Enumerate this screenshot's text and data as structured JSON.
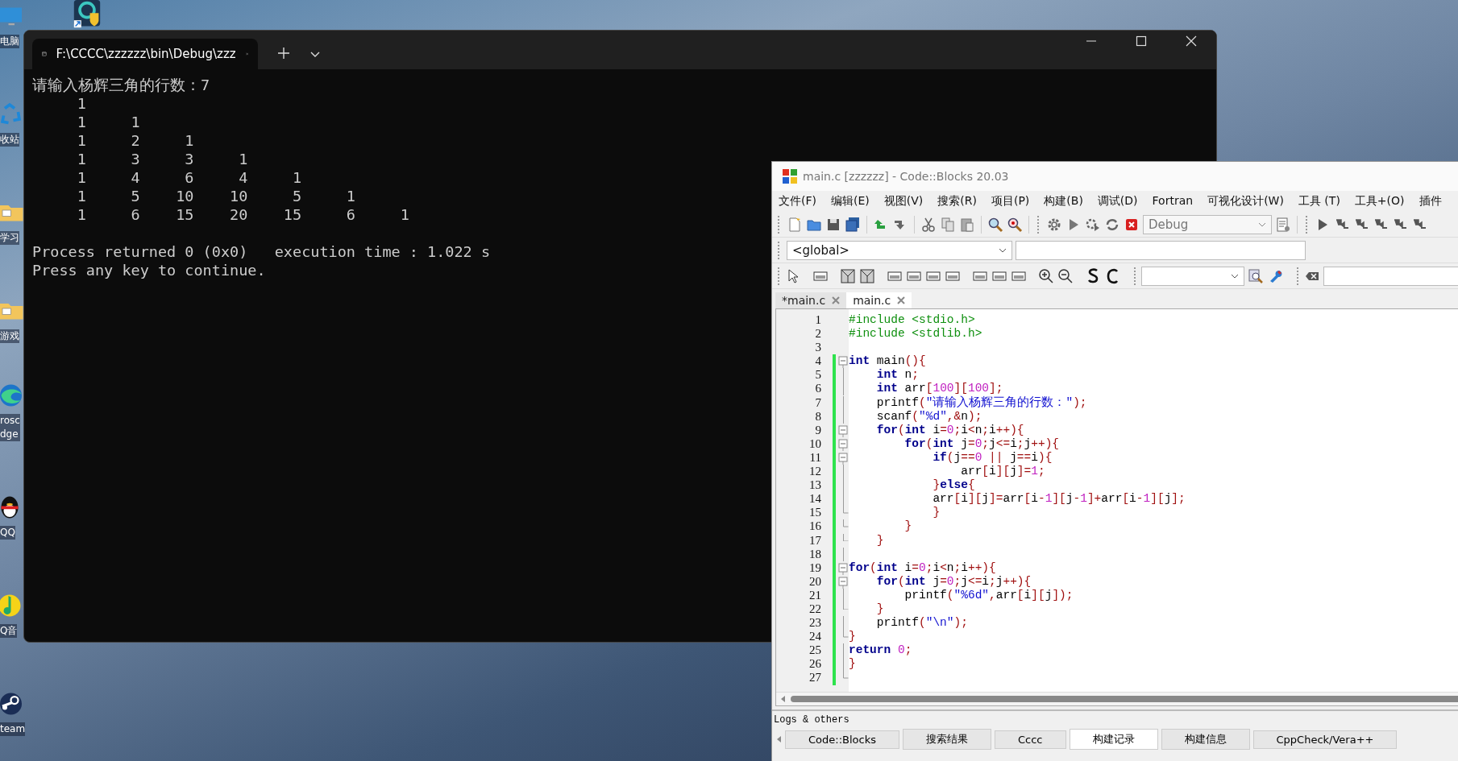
{
  "desktop": {
    "icons": [
      {
        "kind": "pc",
        "label_lines": [
          "电脑"
        ]
      },
      {
        "kind": "recycle",
        "label_lines": [
          "收站"
        ]
      },
      {
        "kind": "folder",
        "label_lines": [
          "学习"
        ]
      },
      {
        "kind": "folder",
        "label_lines": [
          "游戏"
        ]
      },
      {
        "kind": "edge",
        "label_lines": [
          "rosc",
          "dge"
        ]
      },
      {
        "kind": "qq",
        "label_lines": [
          "QQ"
        ]
      },
      {
        "kind": "music",
        "label_lines": [
          "Q音"
        ]
      },
      {
        "kind": "steam",
        "label_lines": [
          "team"
        ]
      }
    ]
  },
  "terminal": {
    "tab_title": "F:\\CCCC\\zzzzzz\\bin\\Debug\\zzz",
    "output_lines": [
      "请输入杨辉三角的行数：7",
      "     1",
      "     1     1",
      "     1     2     1",
      "     1     3     3     1",
      "     1     4     6     4     1",
      "     1     5    10    10     5     1",
      "     1     6    15    20    15     6     1"
    ],
    "status_lines": [
      "Process returned 0 (0x0)   execution time : 1.022 s",
      "Press any key to continue."
    ]
  },
  "codeblocks": {
    "title": "main.c [zzzzzz] - Code::Blocks 20.03",
    "menu": [
      "文件(F)",
      "编辑(E)",
      "视图(V)",
      "搜索(R)",
      "项目(P)",
      "构建(B)",
      "调试(D)",
      "Fortran",
      "可视化设计(W)",
      "工具 (T)",
      "工具+(O)",
      "插件"
    ],
    "build_target": "Debug",
    "scope": "<global>",
    "tabs": [
      {
        "label": "*main.c",
        "selected": false
      },
      {
        "label": "main.c",
        "selected": true
      }
    ],
    "code_lines": [
      {
        "n": "1",
        "kind": "plain",
        "changed": false,
        "tokens": [
          {
            "kind": "pre",
            "text": "#include <stdio.h>"
          }
        ]
      },
      {
        "n": "2",
        "kind": "plain",
        "changed": false,
        "tokens": [
          {
            "kind": "pre",
            "text": "#include <stdlib.h>"
          }
        ]
      },
      {
        "n": "3",
        "kind": "plain",
        "changed": false
      },
      {
        "n": "4",
        "kind": "fold-start",
        "changed": true,
        "tokens": [
          {
            "kind": "kw",
            "text": "int"
          },
          {
            "kind": "id",
            "text": " main"
          },
          {
            "kind": "op",
            "text": "(){"
          }
        ]
      },
      {
        "n": "5",
        "kind": "fold-body",
        "changed": true,
        "tokens": [
          {
            "kind": "kw",
            "text": "    int"
          },
          {
            "kind": "id",
            "text": " n"
          },
          {
            "kind": "op",
            "text": ";"
          }
        ]
      },
      {
        "n": "6",
        "kind": "fold-body",
        "changed": true,
        "tokens": [
          {
            "kind": "kw",
            "text": "    int"
          },
          {
            "kind": "id",
            "text": " arr"
          },
          {
            "kind": "op",
            "text": "["
          },
          {
            "kind": "num",
            "text": "100"
          },
          {
            "kind": "op",
            "text": "]["
          },
          {
            "kind": "num",
            "text": "100"
          },
          {
            "kind": "op",
            "text": "];"
          }
        ]
      },
      {
        "n": "7",
        "kind": "fold-body",
        "changed": true,
        "tokens": [
          {
            "kind": "id",
            "text": "    printf"
          },
          {
            "kind": "op",
            "text": "("
          },
          {
            "kind": "str",
            "text": "\"请输入杨辉三角的行数：\""
          },
          {
            "kind": "op",
            "text": ");"
          }
        ]
      },
      {
        "n": "8",
        "kind": "fold-body",
        "changed": true,
        "tokens": [
          {
            "kind": "id",
            "text": "    scanf"
          },
          {
            "kind": "op",
            "text": "("
          },
          {
            "kind": "str",
            "text": "\"%d\""
          },
          {
            "kind": "op",
            "text": ",&"
          },
          {
            "kind": "id",
            "text": "n"
          },
          {
            "kind": "op",
            "text": ");"
          }
        ]
      },
      {
        "n": "9",
        "kind": "fold-start",
        "changed": true,
        "tokens": [
          {
            "kind": "kw",
            "text": "    for"
          },
          {
            "kind": "op",
            "text": "("
          },
          {
            "kind": "kw",
            "text": "int"
          },
          {
            "kind": "id",
            "text": " i"
          },
          {
            "kind": "op",
            "text": "="
          },
          {
            "kind": "num",
            "text": "0"
          },
          {
            "kind": "op",
            "text": ";"
          },
          {
            "kind": "id",
            "text": "i"
          },
          {
            "kind": "op",
            "text": "<"
          },
          {
            "kind": "id",
            "text": "n"
          },
          {
            "kind": "op",
            "text": ";"
          },
          {
            "kind": "id",
            "text": "i"
          },
          {
            "kind": "op",
            "text": "++){"
          }
        ]
      },
      {
        "n": "10",
        "kind": "fold-start",
        "changed": true,
        "tokens": [
          {
            "kind": "kw",
            "text": "        for"
          },
          {
            "kind": "op",
            "text": "("
          },
          {
            "kind": "kw",
            "text": "int"
          },
          {
            "kind": "id",
            "text": " j"
          },
          {
            "kind": "op",
            "text": "="
          },
          {
            "kind": "num",
            "text": "0"
          },
          {
            "kind": "op",
            "text": ";"
          },
          {
            "kind": "id",
            "text": "j"
          },
          {
            "kind": "op",
            "text": "<="
          },
          {
            "kind": "id",
            "text": "i"
          },
          {
            "kind": "op",
            "text": ";"
          },
          {
            "kind": "id",
            "text": "j"
          },
          {
            "kind": "op",
            "text": "++){"
          }
        ]
      },
      {
        "n": "11",
        "kind": "fold-start",
        "changed": true,
        "tokens": [
          {
            "kind": "kw",
            "text": "            if"
          },
          {
            "kind": "op",
            "text": "("
          },
          {
            "kind": "id",
            "text": "j"
          },
          {
            "kind": "op",
            "text": "=="
          },
          {
            "kind": "num",
            "text": "0"
          },
          {
            "kind": "op",
            "text": " || "
          },
          {
            "kind": "id",
            "text": "j"
          },
          {
            "kind": "op",
            "text": "=="
          },
          {
            "kind": "id",
            "text": "i"
          },
          {
            "kind": "op",
            "text": "){"
          }
        ]
      },
      {
        "n": "12",
        "kind": "fold-body",
        "changed": true,
        "tokens": [
          {
            "kind": "id",
            "text": "                arr"
          },
          {
            "kind": "op",
            "text": "["
          },
          {
            "kind": "id",
            "text": "i"
          },
          {
            "kind": "op",
            "text": "]["
          },
          {
            "kind": "id",
            "text": "j"
          },
          {
            "kind": "op",
            "text": "]="
          },
          {
            "kind": "num",
            "text": "1"
          },
          {
            "kind": "op",
            "text": ";"
          }
        ]
      },
      {
        "n": "13",
        "kind": "fold-body",
        "changed": true,
        "tokens": [
          {
            "kind": "op",
            "text": "            }"
          },
          {
            "kind": "kw",
            "text": "else"
          },
          {
            "kind": "op",
            "text": "{"
          }
        ]
      },
      {
        "n": "14",
        "kind": "fold-body",
        "changed": true,
        "tokens": [
          {
            "kind": "id",
            "text": "            arr"
          },
          {
            "kind": "op",
            "text": "["
          },
          {
            "kind": "id",
            "text": "i"
          },
          {
            "kind": "op",
            "text": "]["
          },
          {
            "kind": "id",
            "text": "j"
          },
          {
            "kind": "op",
            "text": "]="
          },
          {
            "kind": "id",
            "text": "arr"
          },
          {
            "kind": "op",
            "text": "["
          },
          {
            "kind": "id",
            "text": "i"
          },
          {
            "kind": "op",
            "text": "-"
          },
          {
            "kind": "num",
            "text": "1"
          },
          {
            "kind": "op",
            "text": "]["
          },
          {
            "kind": "id",
            "text": "j"
          },
          {
            "kind": "op",
            "text": "-"
          },
          {
            "kind": "num",
            "text": "1"
          },
          {
            "kind": "op",
            "text": "]+"
          },
          {
            "kind": "id",
            "text": "arr"
          },
          {
            "kind": "op",
            "text": "["
          },
          {
            "kind": "id",
            "text": "i"
          },
          {
            "kind": "op",
            "text": "-"
          },
          {
            "kind": "num",
            "text": "1"
          },
          {
            "kind": "op",
            "text": "]["
          },
          {
            "kind": "id",
            "text": "j"
          },
          {
            "kind": "op",
            "text": "];"
          }
        ]
      },
      {
        "n": "15",
        "kind": "fold-end",
        "changed": true,
        "tokens": [
          {
            "kind": "op",
            "text": "            }"
          }
        ]
      },
      {
        "n": "16",
        "kind": "fold-end",
        "changed": true,
        "tokens": [
          {
            "kind": "op",
            "text": "        }"
          }
        ]
      },
      {
        "n": "17",
        "kind": "fold-end",
        "changed": true,
        "tokens": [
          {
            "kind": "op",
            "text": "    }"
          }
        ]
      },
      {
        "n": "18",
        "kind": "fold-body",
        "changed": true
      },
      {
        "n": "19",
        "kind": "fold-start",
        "changed": true,
        "tokens": [
          {
            "kind": "kw",
            "text": "for"
          },
          {
            "kind": "op",
            "text": "("
          },
          {
            "kind": "kw",
            "text": "int"
          },
          {
            "kind": "id",
            "text": " i"
          },
          {
            "kind": "op",
            "text": "="
          },
          {
            "kind": "num",
            "text": "0"
          },
          {
            "kind": "op",
            "text": ";"
          },
          {
            "kind": "id",
            "text": "i"
          },
          {
            "kind": "op",
            "text": "<"
          },
          {
            "kind": "id",
            "text": "n"
          },
          {
            "kind": "op",
            "text": ";"
          },
          {
            "kind": "id",
            "text": "i"
          },
          {
            "kind": "op",
            "text": "++){"
          }
        ]
      },
      {
        "n": "20",
        "kind": "fold-start",
        "changed": true,
        "tokens": [
          {
            "kind": "kw",
            "text": "    for"
          },
          {
            "kind": "op",
            "text": "("
          },
          {
            "kind": "kw",
            "text": "int"
          },
          {
            "kind": "id",
            "text": " j"
          },
          {
            "kind": "op",
            "text": "="
          },
          {
            "kind": "num",
            "text": "0"
          },
          {
            "kind": "op",
            "text": ";"
          },
          {
            "kind": "id",
            "text": "j"
          },
          {
            "kind": "op",
            "text": "<="
          },
          {
            "kind": "id",
            "text": "i"
          },
          {
            "kind": "op",
            "text": ";"
          },
          {
            "kind": "id",
            "text": "j"
          },
          {
            "kind": "op",
            "text": "++){"
          }
        ]
      },
      {
        "n": "21",
        "kind": "fold-body",
        "changed": true,
        "tokens": [
          {
            "kind": "id",
            "text": "        printf"
          },
          {
            "kind": "op",
            "text": "("
          },
          {
            "kind": "str",
            "text": "\"%6d\""
          },
          {
            "kind": "op",
            "text": ","
          },
          {
            "kind": "id",
            "text": "arr"
          },
          {
            "kind": "op",
            "text": "["
          },
          {
            "kind": "id",
            "text": "i"
          },
          {
            "kind": "op",
            "text": "]["
          },
          {
            "kind": "id",
            "text": "j"
          },
          {
            "kind": "op",
            "text": "]);"
          }
        ]
      },
      {
        "n": "22",
        "kind": "fold-end",
        "changed": true,
        "tokens": [
          {
            "kind": "op",
            "text": "    }"
          }
        ]
      },
      {
        "n": "23",
        "kind": "fold-body",
        "changed": true,
        "tokens": [
          {
            "kind": "id",
            "text": "    printf"
          },
          {
            "kind": "op",
            "text": "("
          },
          {
            "kind": "str",
            "text": "\"\\n\""
          },
          {
            "kind": "op",
            "text": ");"
          }
        ]
      },
      {
        "n": "24",
        "kind": "fold-end",
        "changed": true,
        "tokens": [
          {
            "kind": "op",
            "text": "}"
          }
        ]
      },
      {
        "n": "25",
        "kind": "fold-body",
        "changed": true,
        "tokens": [
          {
            "kind": "kw",
            "text": "return"
          },
          {
            "kind": "num",
            "text": " 0"
          },
          {
            "kind": "op",
            "text": ";"
          }
        ]
      },
      {
        "n": "26",
        "kind": "fold-body",
        "changed": true,
        "tokens": [
          {
            "kind": "op",
            "text": "}"
          }
        ]
      },
      {
        "n": "27",
        "kind": "fold-end",
        "changed": true
      }
    ],
    "logs_title": "Logs & others",
    "log_tabs": [
      {
        "label": "Code::Blocks",
        "selected": false
      },
      {
        "label": "搜索结果",
        "selected": false
      },
      {
        "label": "Cccc",
        "selected": false
      },
      {
        "label": "构建记录",
        "selected": true
      },
      {
        "label": "构建信息",
        "selected": false
      },
      {
        "label": "CppCheck/Vera++",
        "selected": false
      }
    ]
  }
}
